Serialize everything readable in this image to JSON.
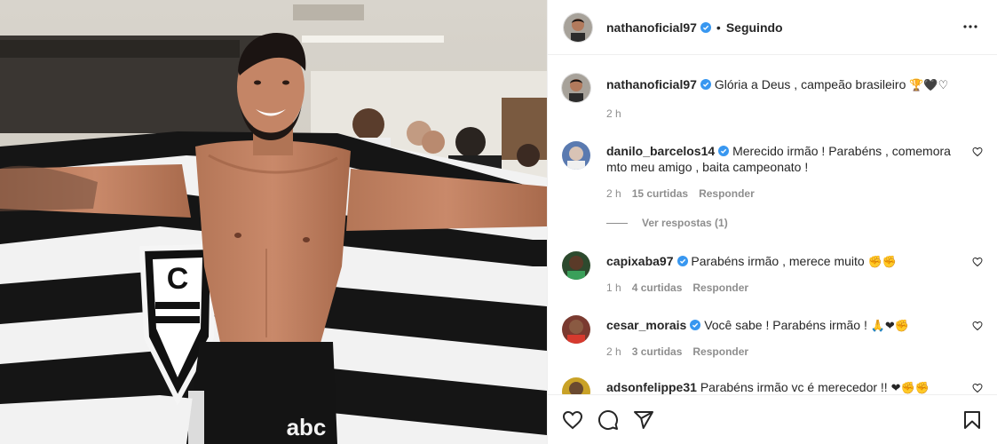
{
  "post": {
    "author": "nathanoficial97",
    "follow_status": "Seguindo",
    "separator": "•",
    "caption": "Glória a Deus , campeão brasileiro",
    "caption_emoji": "🏆🖤♡",
    "time": "2 h",
    "more_icon": "more-horizontal-icon"
  },
  "comments": [
    {
      "user": "danilo_barcelos14",
      "text": "Merecido irmão ! Parabéns , comemora mto meu amigo , baita campeonato !",
      "text_line1": "Merecido irmão ! Parabéns , comemora",
      "text_line2": "mto meu amigo , baita campeonato !",
      "time": "2 h",
      "likes": "15 curtidas",
      "reply": "Responder",
      "view_replies": "Ver respostas (1)"
    },
    {
      "user": "capixaba97",
      "text": "Parabéns irmão , merece muito",
      "emoji": "✊✊",
      "time": "1 h",
      "likes": "4 curtidas",
      "reply": "Responder"
    },
    {
      "user": "cesar_morais",
      "text": "Você sabe ! Parabéns irmão !",
      "emoji": "🙏❤✊",
      "time": "2 h",
      "likes": "3 curtidas",
      "reply": "Responder"
    },
    {
      "user": "adsonfelippe31",
      "text": "Parabéns irmão vc é merecedor !!",
      "emoji": "❤✊✊"
    }
  ],
  "photo": {
    "flag_text": "C",
    "shorts_brand": "abc"
  },
  "colors": {
    "verified": "#3897f0",
    "muted": "#8e8e8e",
    "text": "#262626",
    "border": "#efefef"
  }
}
